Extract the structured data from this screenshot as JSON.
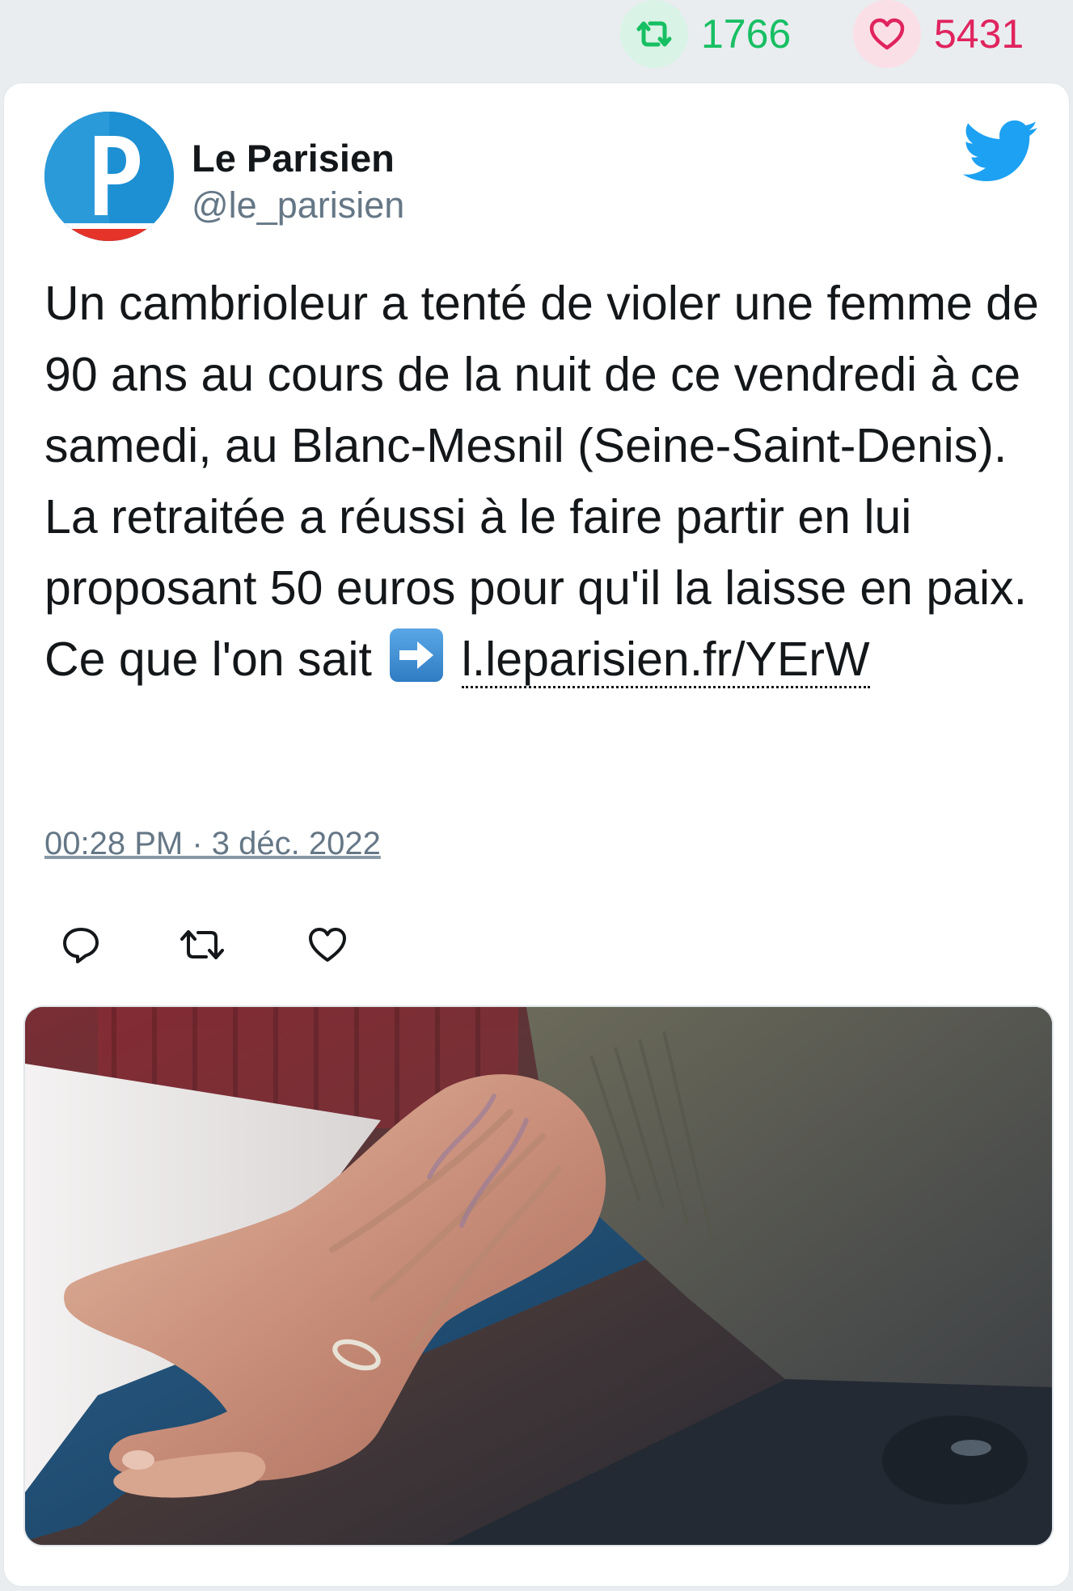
{
  "stats": {
    "retweets": "1766",
    "likes": "5431"
  },
  "tweet": {
    "author_name": "Le Parisien",
    "author_handle": "@le_parisien",
    "avatar_letter": "P",
    "text_main": "Un cambrioleur a tenté de violer une femme de 90 ans au cours de la nuit de ce vendredi à ce samedi, au Blanc-Mesnil (Seine-Saint-Denis). La retraitée a réussi à le faire partir en lui proposant 50 euros pour qu'il la laisse en paix. Ce que l'on sait",
    "link_text": "l.leparisien.fr/YErW",
    "timestamp": "00:28 PM · 3 déc. 2022",
    "emoji": "right-arrow-emoji"
  },
  "colors": {
    "retweet": "#17bf63",
    "like": "#e0245e",
    "twitter_blue": "#1da1f2",
    "text": "#14171a",
    "muted": "#657786"
  },
  "icons": {
    "retweet": "retweet-icon",
    "like": "heart-icon",
    "reply": "reply-icon",
    "twitter": "twitter-bird-icon"
  }
}
